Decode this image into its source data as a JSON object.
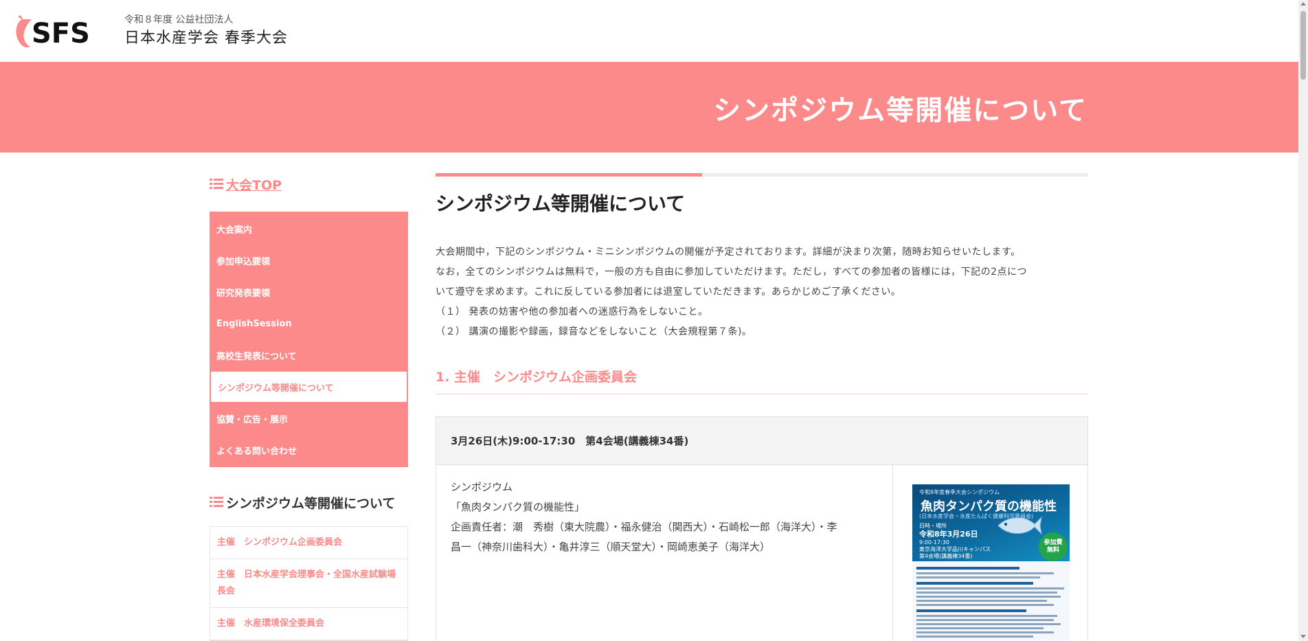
{
  "header": {
    "logo_text": "SFS",
    "subtitle": "令和８年度 公益社団法人",
    "title": "日本水産学会 春季大会"
  },
  "banner": {
    "title": "シンポジウム等開催について"
  },
  "sidebar": {
    "top_link": "大会TOP",
    "nav": [
      {
        "label": "大会案内"
      },
      {
        "label": "参加申込要領"
      },
      {
        "label": "研究発表要領"
      },
      {
        "label": "EnglishSession"
      },
      {
        "label": "高校生発表について"
      },
      {
        "label": "シンポジウム等開催について",
        "active": true
      },
      {
        "label": "協賛・広告・展示"
      },
      {
        "label": "よくある問い合わせ"
      }
    ],
    "section_heading": "シンポジウム等開催について",
    "subnav": [
      {
        "label": "主催　シンポジウム企画委員会"
      },
      {
        "label": "主催　日本水産学会理事会・全国水産試験場長会"
      },
      {
        "label": "主催　水産環境保全委員会"
      }
    ]
  },
  "main": {
    "title": "シンポジウム等開催について",
    "intro": [
      "大会期間中，下記のシンポジウム・ミニシンポジウムの開催が予定されております。詳細が決まり次第，随時お知らせいたします。",
      "なお，全てのシンポジウムは無料で，一般の方も自由に参加していただけます。ただし，すべての参加者の皆様には，下記の2点につ",
      "いて遵守を求めます。これに反している参加者には退室していただきます。あらかじめご了承ください。",
      "（１） 発表の妨害や他の参加者への迷惑行為をしないこと。",
      "（２） 講演の撮影や録画，録音などをしないこと（大会規程第７条)。"
    ],
    "section1_heading": "1.  主催　シンポジウム企画委員会",
    "card": {
      "header": "3月26日(木)9:00-17:30　第4会場(講義棟34番)",
      "lines": [
        "シンポジウム",
        "「魚肉タンパク質の機能性」",
        "企画責任者：潮　秀樹（東大院農）・福永健治（関西大）・石崎松一郎（海洋大）・李",
        "昌一（神奈川歯科大）・亀井淳三（順天堂大）・岡崎恵美子（海洋大）"
      ],
      "poster": {
        "small": "令和8年度春季大会シンポジウム",
        "title": "魚肉タンパク質の機能性",
        "sub": "(日本水産学会・水産たんぱく健康科学委員会)",
        "date_label": "日時・場所",
        "date": "令和8年3月26日",
        "time": "9:00-17:30",
        "venue1": "東京海洋大学品川キャンパス",
        "venue2": "第4会場(講義棟34番)",
        "badge": "参加費\n無料",
        "accent": "#0c6aa0",
        "badge_color": "#23a34a"
      }
    }
  },
  "colors": {
    "accent": "#fc8a8a",
    "banner": "#fc8a8a"
  }
}
